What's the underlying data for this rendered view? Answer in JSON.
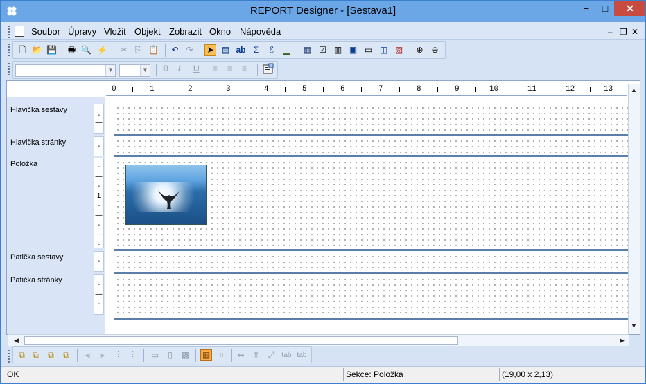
{
  "window": {
    "title": "REPORT Designer - [Sestava1]",
    "buttons": {
      "minimize": "−",
      "maximize": "□",
      "close": "✕"
    },
    "mdi_buttons": {
      "minimize": "‒",
      "restore": "❐",
      "close": "✕"
    }
  },
  "menu": [
    {
      "label": "Soubor"
    },
    {
      "label": "Úpravy"
    },
    {
      "label": "Vložit"
    },
    {
      "label": "Objekt"
    },
    {
      "label": "Zobrazit"
    },
    {
      "label": "Okno"
    },
    {
      "label": "Nápověda"
    }
  ],
  "toolbar_main": [
    {
      "icon": "new-document-icon",
      "glyph": "🗋"
    },
    {
      "icon": "open-folder-icon",
      "glyph": "📂"
    },
    {
      "icon": "save-icon",
      "glyph": "💾"
    },
    {
      "icon": "print-icon",
      "glyph": "🖶"
    },
    {
      "icon": "print-preview-icon",
      "glyph": "🔍"
    },
    {
      "icon": "run-icon",
      "glyph": "⚡"
    },
    {
      "icon": "cut-icon",
      "glyph": "✂"
    },
    {
      "icon": "copy-icon",
      "glyph": "⎘"
    },
    {
      "icon": "paste-icon",
      "glyph": "📋"
    },
    {
      "icon": "undo-icon",
      "glyph": "↶"
    },
    {
      "icon": "redo-icon",
      "glyph": "↷"
    },
    {
      "icon": "select-pointer-icon",
      "glyph": "➤"
    },
    {
      "icon": "text-field-icon",
      "glyph": "▤"
    },
    {
      "icon": "label-ab-icon",
      "glyph": "ab"
    },
    {
      "icon": "sum-icon",
      "glyph": "Σ"
    },
    {
      "icon": "formula-icon",
      "glyph": "ℰ"
    },
    {
      "icon": "line-icon",
      "glyph": "▁"
    },
    {
      "icon": "group-icon",
      "glyph": "▦"
    },
    {
      "icon": "checkbox-icon",
      "glyph": "☑"
    },
    {
      "icon": "barcode-icon",
      "glyph": "▥"
    },
    {
      "icon": "monitor-icon",
      "glyph": "▣"
    },
    {
      "icon": "counter-icon",
      "glyph": "▭"
    },
    {
      "icon": "display-icon",
      "glyph": "◫"
    },
    {
      "icon": "chart-icon",
      "glyph": "▧"
    },
    {
      "icon": "zoom-in-icon",
      "glyph": "⊕"
    },
    {
      "icon": "zoom-out-icon",
      "glyph": "⊖"
    }
  ],
  "format_toolbar": {
    "font_name": "",
    "font_size": "",
    "bold": "B",
    "italic": "I",
    "underline": "U",
    "align_left": "≡",
    "align_center": "≡",
    "align_right": "≡",
    "properties_icon": "properties-icon"
  },
  "ruler": [
    "0",
    "1",
    "2",
    "3",
    "4",
    "5",
    "6",
    "7",
    "8",
    "9",
    "10",
    "11",
    "12",
    "13"
  ],
  "sections": [
    {
      "label": "Hlavička sestavy",
      "marks": [
        "-",
        "—"
      ]
    },
    {
      "label": "Hlavička stránky",
      "marks": [
        "-"
      ]
    },
    {
      "label": "Položka",
      "marks": [
        "-",
        "—",
        "-",
        "1",
        "-",
        "—",
        "-",
        "—",
        "-"
      ]
    },
    {
      "label": "Patička sestavy",
      "marks": [
        "-"
      ]
    },
    {
      "label": "Patička stránky",
      "marks": [
        "-",
        "—",
        "-"
      ]
    }
  ],
  "image": {
    "name": "whale-image"
  },
  "bottom_toolbar": [
    {
      "icon": "bring-front-icon",
      "glyph": "⧉"
    },
    {
      "icon": "send-back-icon",
      "glyph": "⧉"
    },
    {
      "icon": "bring-forward-icon",
      "glyph": "⧉"
    },
    {
      "icon": "send-backward-icon",
      "glyph": "⧉"
    },
    {
      "icon": "align-left-icon",
      "glyph": "⫷"
    },
    {
      "icon": "align-right-icon",
      "glyph": "⫸"
    },
    {
      "icon": "align-top-icon",
      "glyph": "⫶"
    },
    {
      "icon": "align-bottom-icon",
      "glyph": "⫶"
    },
    {
      "icon": "same-width-icon",
      "glyph": "▭"
    },
    {
      "icon": "same-height-icon",
      "glyph": "▯"
    },
    {
      "icon": "same-size-icon",
      "glyph": "▩"
    },
    {
      "icon": "grid-icon",
      "glyph": "▦"
    },
    {
      "icon": "snap-icon",
      "glyph": "⌗"
    },
    {
      "icon": "space-horizontal-icon",
      "glyph": "⇹"
    },
    {
      "icon": "space-vertical-icon",
      "glyph": "⇳"
    },
    {
      "icon": "distribute-icon",
      "glyph": "⤢"
    },
    {
      "icon": "tab-order-icon",
      "glyph": "tab"
    },
    {
      "icon": "tab-order-2-icon",
      "glyph": "tab"
    }
  ],
  "status": {
    "left": "OK",
    "section": "Sekce: Položka",
    "size": "(19,00 x 2,13)"
  }
}
